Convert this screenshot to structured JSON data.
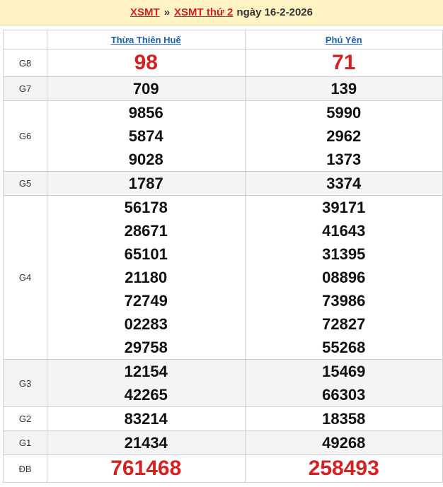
{
  "header": {
    "link1": "XSMT",
    "separator": "»",
    "link2": "XSMT thứ 2",
    "date_text": "ngày 16-2-2026"
  },
  "provinces": [
    "Thừa Thiên Huế",
    "Phú Yên"
  ],
  "colors": {
    "accent_red": "#d42121",
    "link_blue": "#1a5fa8",
    "header_bg": "#fff3c4"
  },
  "rows": [
    {
      "prize": "G8",
      "a": [
        "98"
      ],
      "b": [
        "71"
      ]
    },
    {
      "prize": "G7",
      "a": [
        "709"
      ],
      "b": [
        "139"
      ]
    },
    {
      "prize": "G6",
      "a": [
        "9856",
        "5874",
        "9028"
      ],
      "b": [
        "5990",
        "2962",
        "1373"
      ]
    },
    {
      "prize": "G5",
      "a": [
        "1787"
      ],
      "b": [
        "3374"
      ]
    },
    {
      "prize": "G4",
      "a": [
        "56178",
        "28671",
        "65101",
        "21180",
        "72749",
        "02283",
        "29758"
      ],
      "b": [
        "39171",
        "41643",
        "31395",
        "08896",
        "73986",
        "72827",
        "55268"
      ]
    },
    {
      "prize": "G3",
      "a": [
        "12154",
        "42265"
      ],
      "b": [
        "15469",
        "66303"
      ]
    },
    {
      "prize": "G2",
      "a": [
        "83214"
      ],
      "b": [
        "18358"
      ]
    },
    {
      "prize": "G1",
      "a": [
        "21434"
      ],
      "b": [
        "49268"
      ]
    },
    {
      "prize": "ĐB",
      "a": [
        "761468"
      ],
      "b": [
        "258493"
      ]
    }
  ]
}
